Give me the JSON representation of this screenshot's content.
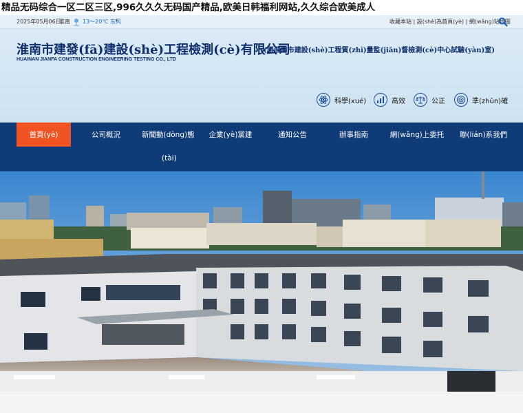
{
  "site_title": "精品无码综合一区二区三区,996久久久无码国产精品,欧美日韩福利网站,久久综合欧美成人",
  "utility": {
    "date": "2025年05月06日",
    "city": "淮南",
    "temp": "13～20℃ 东风",
    "more": "»",
    "links": [
      "收藏本站",
      "設(shè)為首頁(yè)",
      "網(wǎng)站地圖"
    ]
  },
  "company": {
    "name": "淮南市建發(fā)建設(shè)工程檢測(cè)有限公司",
    "former_name": "(原淮南市建設(shè)工程質(zhì)量監(jiān)督檢測(cè)中心試驗(yàn)室)",
    "english_name": "HUAINAN JIANFA CONSTRUCTION ENGINEERING TESTING CO., LTD"
  },
  "values": [
    {
      "icon": "atom-icon",
      "label": "科學(xué)"
    },
    {
      "icon": "chart-icon",
      "label": "高效"
    },
    {
      "icon": "scale-icon",
      "label": "公正"
    },
    {
      "icon": "target-icon",
      "label": "準(zhǔn)確"
    }
  ],
  "nav": {
    "items": [
      "首頁(yè)",
      "公司概況",
      "新聞動(dòng)態(tài)",
      "企業(yè)黨建",
      "通知公告",
      "辦事指南",
      "網(wǎng)上委托",
      "聯(lián)系我們"
    ],
    "wrapped_item": "新聞動(dòng)態(tài)",
    "active_index": 0
  },
  "colors": {
    "nav_bg": "#0f3b79",
    "nav_active": "#f05423",
    "header_bg": "#d6e7f4",
    "brand_text": "#0f2d6b",
    "weather_temp": "#1b6bd1"
  }
}
